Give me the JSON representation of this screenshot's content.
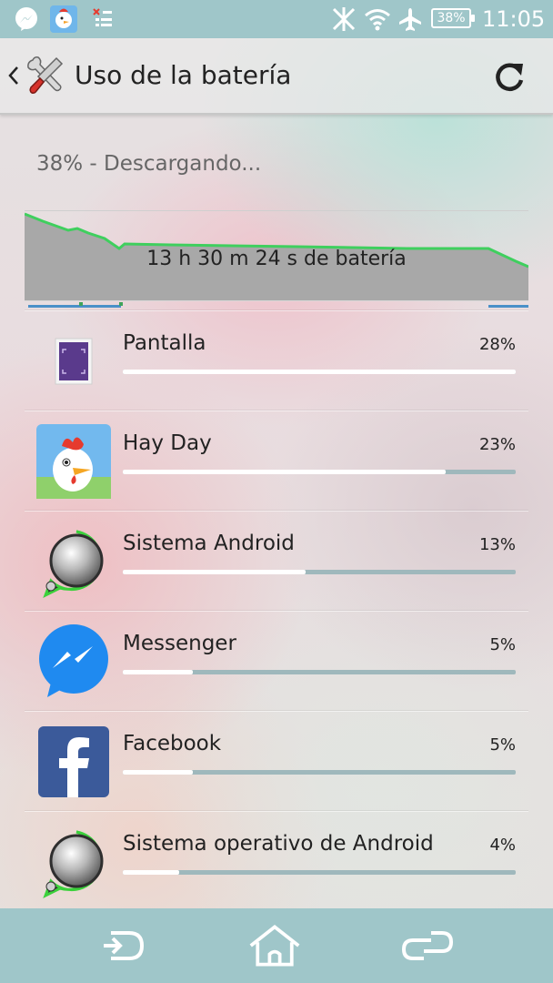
{
  "status_bar": {
    "notification_icons": [
      "messenger-icon",
      "hay-day-icon",
      "sync-off-icon"
    ],
    "system_icons": [
      "nfc-off-icon",
      "wifi-icon",
      "airplane-mode-icon"
    ],
    "battery_level": "38%",
    "time": "11:05"
  },
  "action_bar": {
    "title": "Uso de la batería",
    "icons": [
      "back-chevron-icon",
      "settings-tools-icon",
      "refresh-icon"
    ]
  },
  "battery": {
    "status": "38% - Descargando...",
    "graph_label": "13 h 30 m 24 s de batería",
    "level_fraction": 0.38,
    "colors": {
      "line": "#3fcf5e",
      "area": "#a8a8a8",
      "track": "#4a90c8"
    }
  },
  "usage": [
    {
      "name": "Pantalla",
      "percent": "28%",
      "value": 28,
      "icon": "screen-icon"
    },
    {
      "name": "Hay Day",
      "percent": "23%",
      "value": 23,
      "icon": "hay-day-icon"
    },
    {
      "name": "Sistema Android",
      "percent": "13%",
      "value": 13,
      "icon": "android-system-icon"
    },
    {
      "name": "Messenger",
      "percent": "5%",
      "value": 5,
      "icon": "messenger-icon"
    },
    {
      "name": "Facebook",
      "percent": "5%",
      "value": 5,
      "icon": "facebook-icon"
    },
    {
      "name": "Sistema operativo de Android",
      "percent": "4%",
      "value": 4,
      "icon": "android-os-icon"
    }
  ],
  "nav_bar": {
    "buttons": [
      "back-icon",
      "home-icon",
      "recent-apps-icon"
    ]
  },
  "theme": {
    "bar_color": "#9fc6c9",
    "bar_fill": "#ffffff",
    "bar_track": "#9fb8bc"
  }
}
